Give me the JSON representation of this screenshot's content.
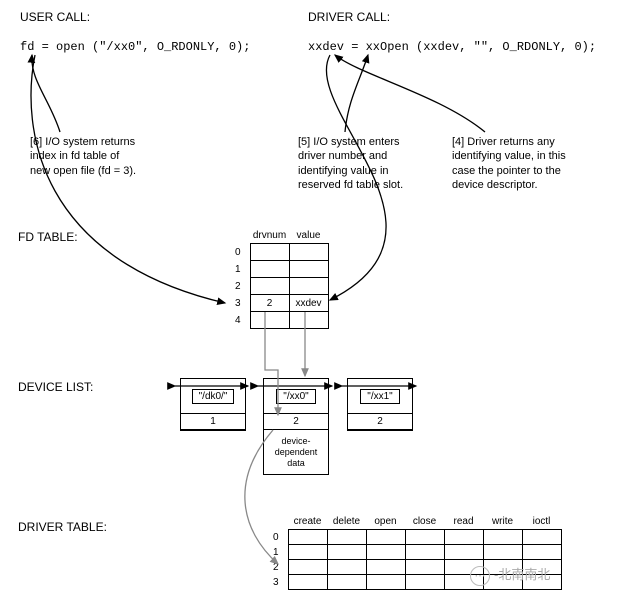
{
  "headers": {
    "user_call": "USER CALL:",
    "driver_call": "DRIVER CALL:"
  },
  "code": {
    "user": "fd = open (\"/xx0\", O_RDONLY, 0);",
    "driver": "xxdev = xxOpen (xxdev, \"\", O_RDONLY, 0);"
  },
  "notes": {
    "n6": "[6] I/O system returns index in fd table of new open file (fd = 3).",
    "n5": "[5] I/O system enters driver number and identifying value in reserved fd table slot.",
    "n4": "[4] Driver returns any identifying value, in this case the pointer to the device descriptor."
  },
  "sections": {
    "fd_table": "FD TABLE:",
    "device_list": "DEVICE LIST:",
    "driver_table": "DRIVER TABLE:"
  },
  "fd_table": {
    "cols": [
      "drvnum",
      "value"
    ],
    "rows": [
      {
        "idx": "0",
        "drvnum": "",
        "value": ""
      },
      {
        "idx": "1",
        "drvnum": "",
        "value": ""
      },
      {
        "idx": "2",
        "drvnum": "",
        "value": ""
      },
      {
        "idx": "3",
        "drvnum": "2",
        "value": "xxdev"
      },
      {
        "idx": "4",
        "drvnum": "",
        "value": ""
      }
    ]
  },
  "device_list": {
    "items": [
      {
        "name": "\"/dk0/\"",
        "num": "1",
        "extra": ""
      },
      {
        "name": "\"/xx0\"",
        "num": "2",
        "extra": "device-\ndependent\ndata"
      },
      {
        "name": "\"/xx1\"",
        "num": "2",
        "extra": ""
      }
    ]
  },
  "driver_table": {
    "cols": [
      "create",
      "delete",
      "open",
      "close",
      "read",
      "write",
      "ioctl"
    ],
    "row_indices": [
      "0",
      "1",
      "2",
      "3"
    ]
  },
  "watermark": {
    "icon": "⋯",
    "text": "-北南南北"
  }
}
